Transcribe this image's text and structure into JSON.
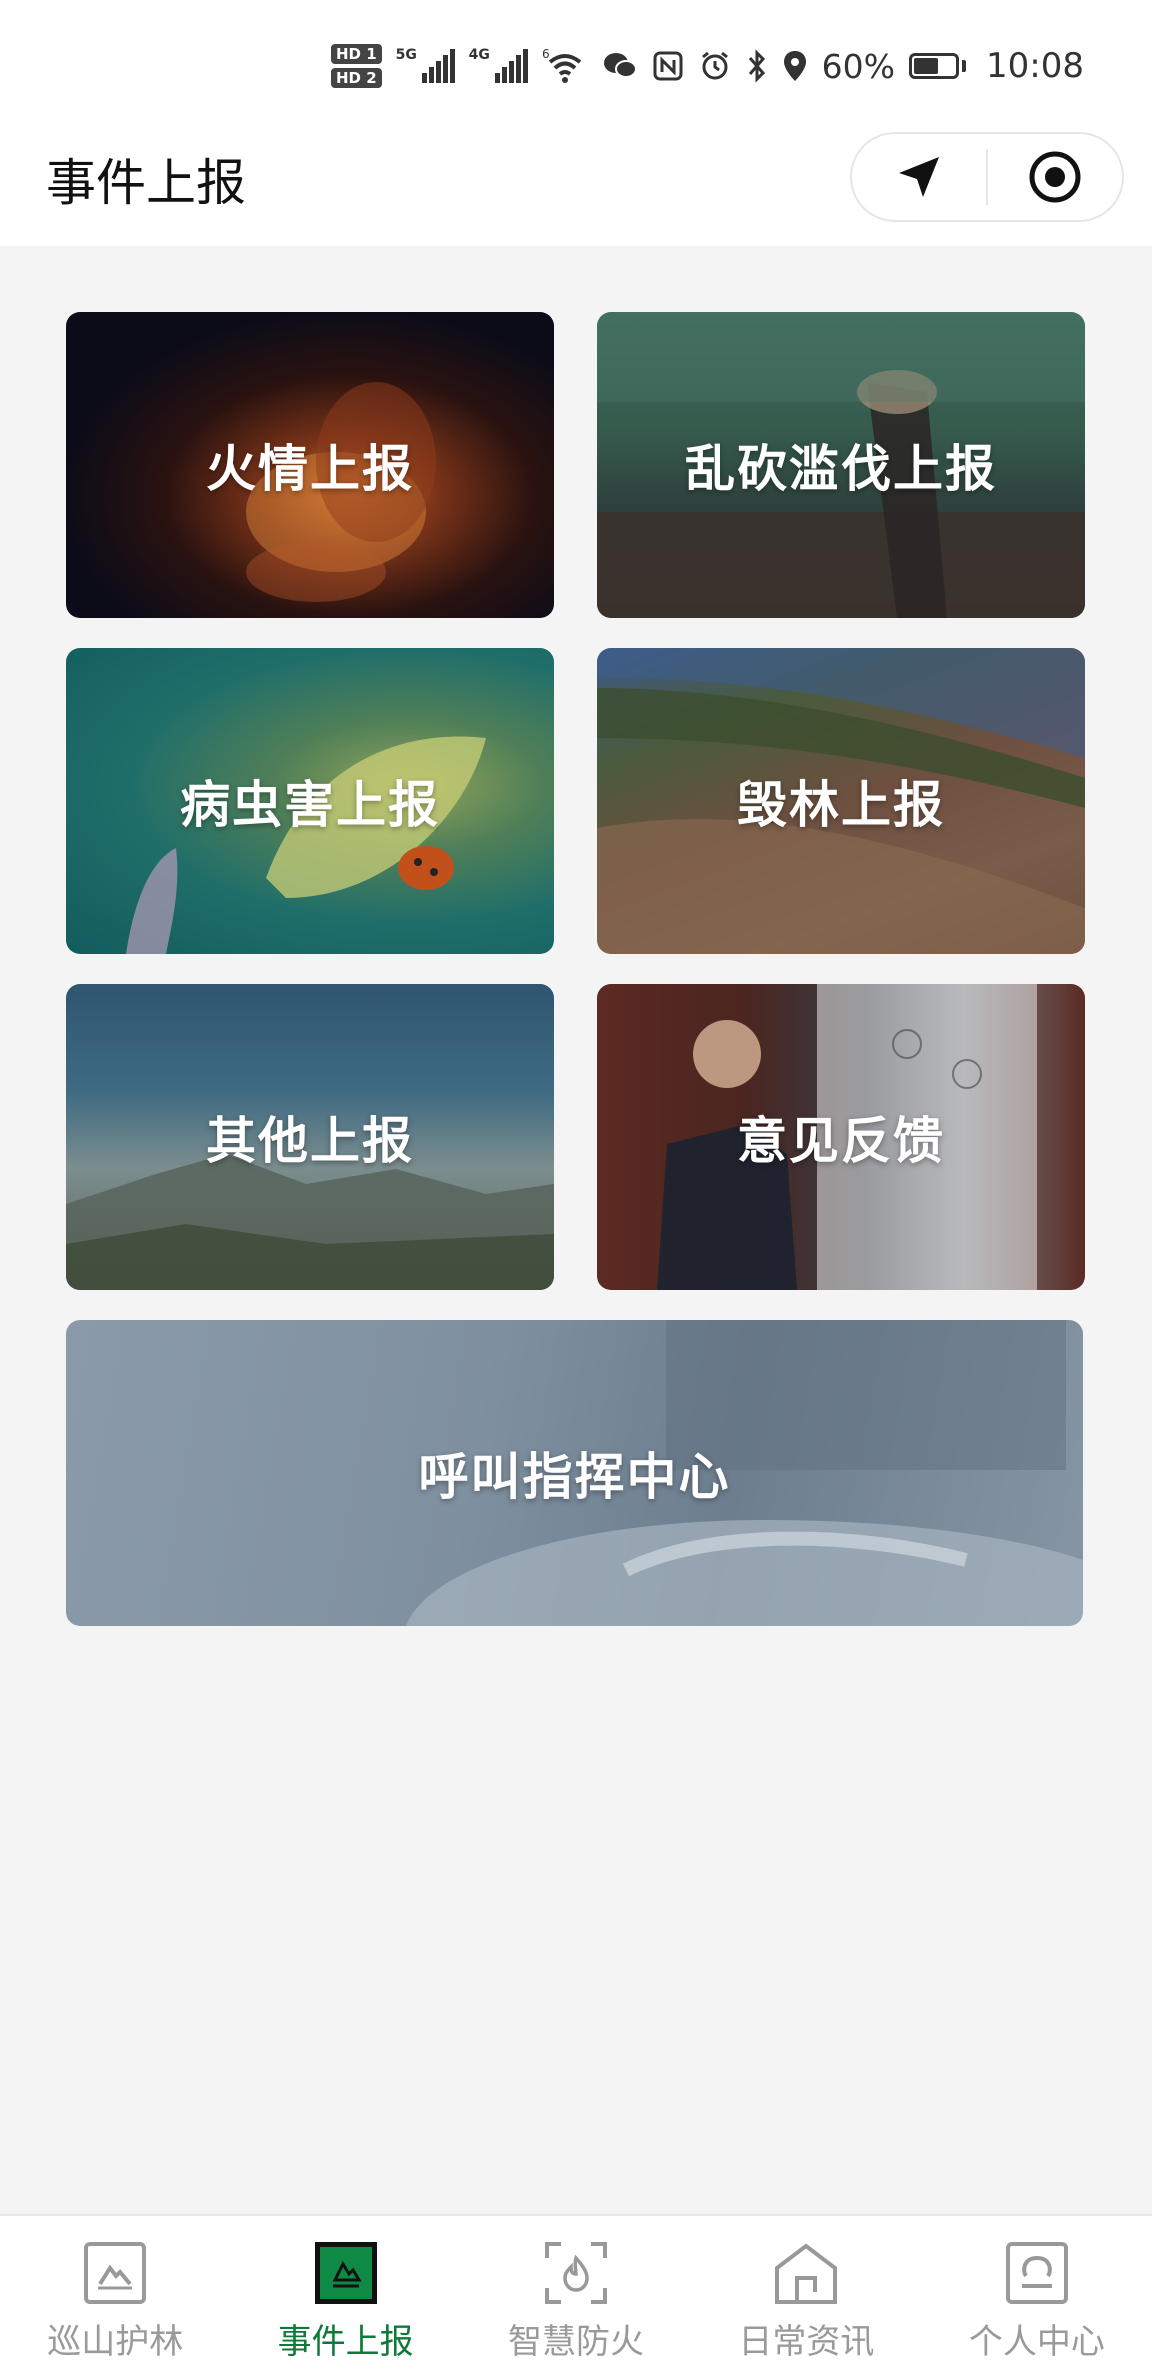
{
  "status_bar": {
    "hd_labels": [
      "HD 1",
      "HD 2"
    ],
    "network_1": "5G",
    "network_2": "4G",
    "wifi_label": "6",
    "battery_percent": "60%",
    "time": "10:08"
  },
  "header": {
    "title": "事件上报"
  },
  "cards": {
    "fire": "火情上报",
    "logging": "乱砍滥伐上报",
    "pest": "病虫害上报",
    "destroy": "毁林上报",
    "other": "其他上报",
    "feedback": "意见反馈",
    "call": "呼叫指挥中心"
  },
  "tabs": [
    {
      "label": "巡山护林",
      "icon": "mountain-icon",
      "active": false
    },
    {
      "label": "事件上报",
      "icon": "report-icon",
      "active": true
    },
    {
      "label": "智慧防火",
      "icon": "fire-scan-icon",
      "active": false
    },
    {
      "label": "日常资讯",
      "icon": "home-icon",
      "active": false
    },
    {
      "label": "个人中心",
      "icon": "user-icon",
      "active": false
    }
  ],
  "colors": {
    "active_tab": "#0d7a3a",
    "inactive_tab": "#9a9a9a",
    "background": "#f4f4f5"
  }
}
